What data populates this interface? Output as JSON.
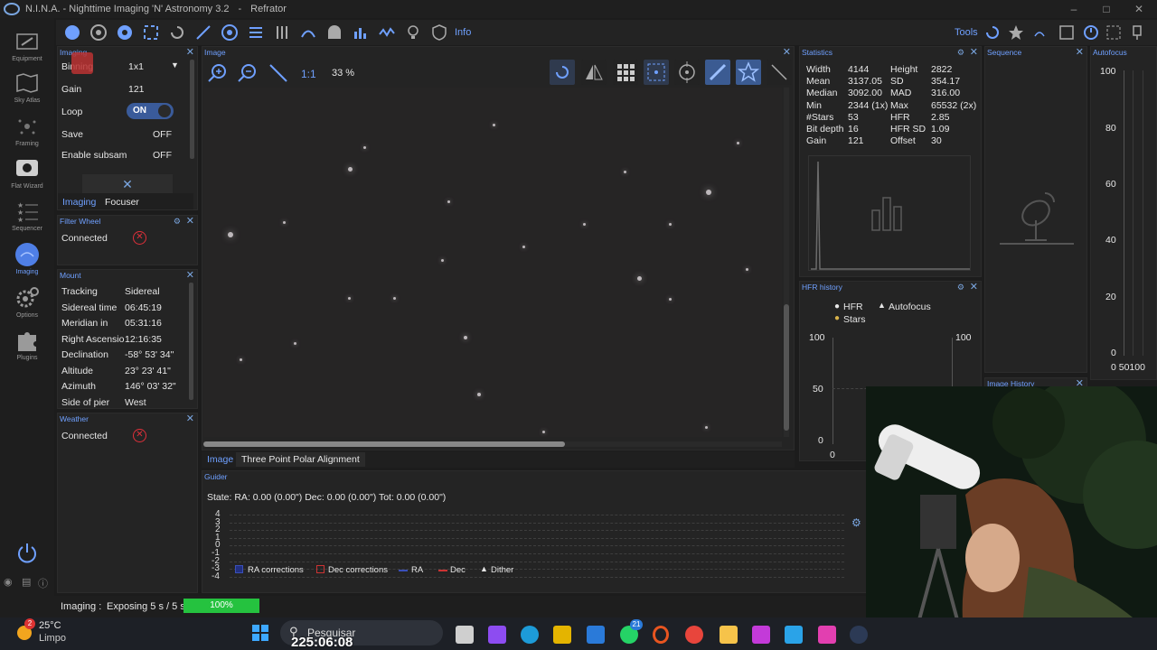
{
  "window": {
    "title": "N.I.N.A. - Nighttime Imaging 'N' Astronomy 3.2",
    "profile": "Refrator"
  },
  "nav": [
    {
      "label": "Equipment",
      "icon": "equipment-icon"
    },
    {
      "label": "Sky Atlas",
      "icon": "sky-atlas-icon"
    },
    {
      "label": "Framing",
      "icon": "framing-icon"
    },
    {
      "label": "Flat Wizard",
      "icon": "flat-wizard-icon"
    },
    {
      "label": "Sequencer",
      "icon": "sequencer-icon"
    },
    {
      "label": "Imaging",
      "icon": "imaging-icon"
    },
    {
      "label": "Options",
      "icon": "options-icon"
    },
    {
      "label": "Plugins",
      "icon": "plugins-icon"
    }
  ],
  "nav_collapse": "<<",
  "toolbar": {
    "info_label": "Info",
    "tools_label": "Tools"
  },
  "imaging_panel": {
    "title": "Imaging",
    "binning_label": "Binning",
    "binning_value": "1x1",
    "gain_label": "Gain",
    "gain_value": "121",
    "loop_label": "Loop",
    "loop_value": "ON",
    "save_label": "Save",
    "save_value": "OFF",
    "subsample_label": "Enable subsam",
    "subsample_value": "OFF",
    "tab_imaging": "Imaging",
    "tab_focuser": "Focuser"
  },
  "filter_wheel": {
    "title": "Filter Wheel",
    "status": "Connected"
  },
  "mount": {
    "title": "Mount",
    "rows": [
      {
        "label": "Tracking",
        "value": "Sidereal"
      },
      {
        "label": "Sidereal time",
        "value": "06:45:19"
      },
      {
        "label": "Meridian in",
        "value": "05:31:16"
      },
      {
        "label": "Right Ascension",
        "value": "12:16:35"
      },
      {
        "label": "Declination",
        "value": "-58° 53' 34\""
      },
      {
        "label": "Altitude",
        "value": "23° 23' 41\""
      },
      {
        "label": "Azimuth",
        "value": "146° 03' 32\""
      },
      {
        "label": "Side of pier",
        "value": "West"
      }
    ]
  },
  "weather": {
    "title": "Weather",
    "status": "Connected"
  },
  "image_panel": {
    "title": "Image",
    "zoom_1to1": "1:1",
    "zoom_percent": "33 %",
    "tab_image": "Image",
    "tab_tppa": "Three Point Polar Alignment"
  },
  "statistics": {
    "title": "Statistics",
    "left": [
      {
        "label": "Width",
        "value": "4144"
      },
      {
        "label": "Mean",
        "value": "3137.05"
      },
      {
        "label": "Median",
        "value": "3092.00"
      },
      {
        "label": "Min",
        "value": "2344 (1x)"
      },
      {
        "label": "#Stars",
        "value": "53"
      },
      {
        "label": "Bit depth",
        "value": "16"
      },
      {
        "label": "Gain",
        "value": "121"
      }
    ],
    "right": [
      {
        "label": "Height",
        "value": "2822"
      },
      {
        "label": "SD",
        "value": "354.17"
      },
      {
        "label": "MAD",
        "value": "316.00"
      },
      {
        "label": "Max",
        "value": "65532 (2x)"
      },
      {
        "label": "HFR",
        "value": "2.85"
      },
      {
        "label": "HFR SD",
        "value": "1.09"
      },
      {
        "label": "Offset",
        "value": "30"
      }
    ]
  },
  "hfr_history": {
    "title": "HFR history",
    "legend_hfr": "HFR",
    "legend_autofocus": "Autofocus",
    "legend_stars": "Stars",
    "y_left_ticks": [
      "100",
      "50",
      "0"
    ],
    "y_right_ticks": [
      "100"
    ],
    "x_tick": "0"
  },
  "sequence": {
    "title": "Sequence"
  },
  "image_history": {
    "title": "Image History"
  },
  "autofocus": {
    "title": "Autofocus",
    "y_ticks": [
      "100",
      "80",
      "60",
      "40",
      "20",
      "0"
    ],
    "x_ticks": "0 50100"
  },
  "guider": {
    "title": "Guider",
    "state": "State:  RA: 0.00 (0.00\")  Dec: 0.00 (0.00\")  Tot: 0.00 (0.00\")",
    "y_ticks": [
      "4",
      "3",
      "2",
      "1",
      "0",
      "-1",
      "-2",
      "-3",
      "-4"
    ],
    "legend": [
      "RA corrections",
      "Dec corrections",
      "RA",
      "Dec",
      "Dither"
    ]
  },
  "status_bar": {
    "label": "Imaging :",
    "message": "Exposing 5 s / 5 s",
    "progress_label": "100%",
    "progress_fraction": 1.0
  },
  "taskbar": {
    "weather_temp": "25°C",
    "weather_desc": "Limpo",
    "weather_badge": "2",
    "search_placeholder": "Pesquisar",
    "whatsapp_badge": "21"
  },
  "overlay_timer": "225:06:08",
  "colors": {
    "accent": "#6fa0ff",
    "error": "#e0303a",
    "progress": "#25c23f"
  }
}
